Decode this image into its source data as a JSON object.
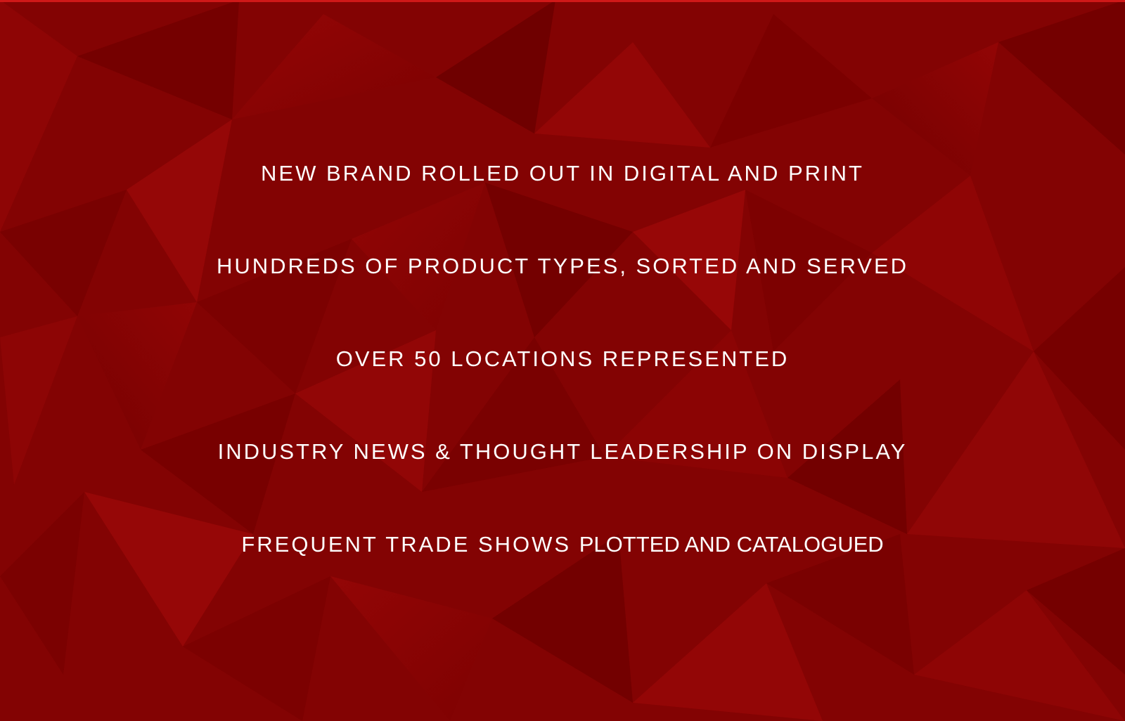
{
  "theme": {
    "background": "#820202",
    "accent": "#d01818",
    "text_color": "#ffffff"
  },
  "lines": [
    "NEW BRAND ROLLED OUT IN DIGITAL AND PRINT",
    "HUNDREDS OF PRODUCT TYPES, SORTED AND SERVED",
    "OVER 50 LOCATIONS REPRESENTED",
    "INDUSTRY NEWS & THOUGHT LEADERSHIP ON DISPLAY"
  ],
  "last_line": {
    "part1": "FREQUENT TRADE SHOWS",
    "part2": "PLOTTED AND CATALOGUED"
  }
}
